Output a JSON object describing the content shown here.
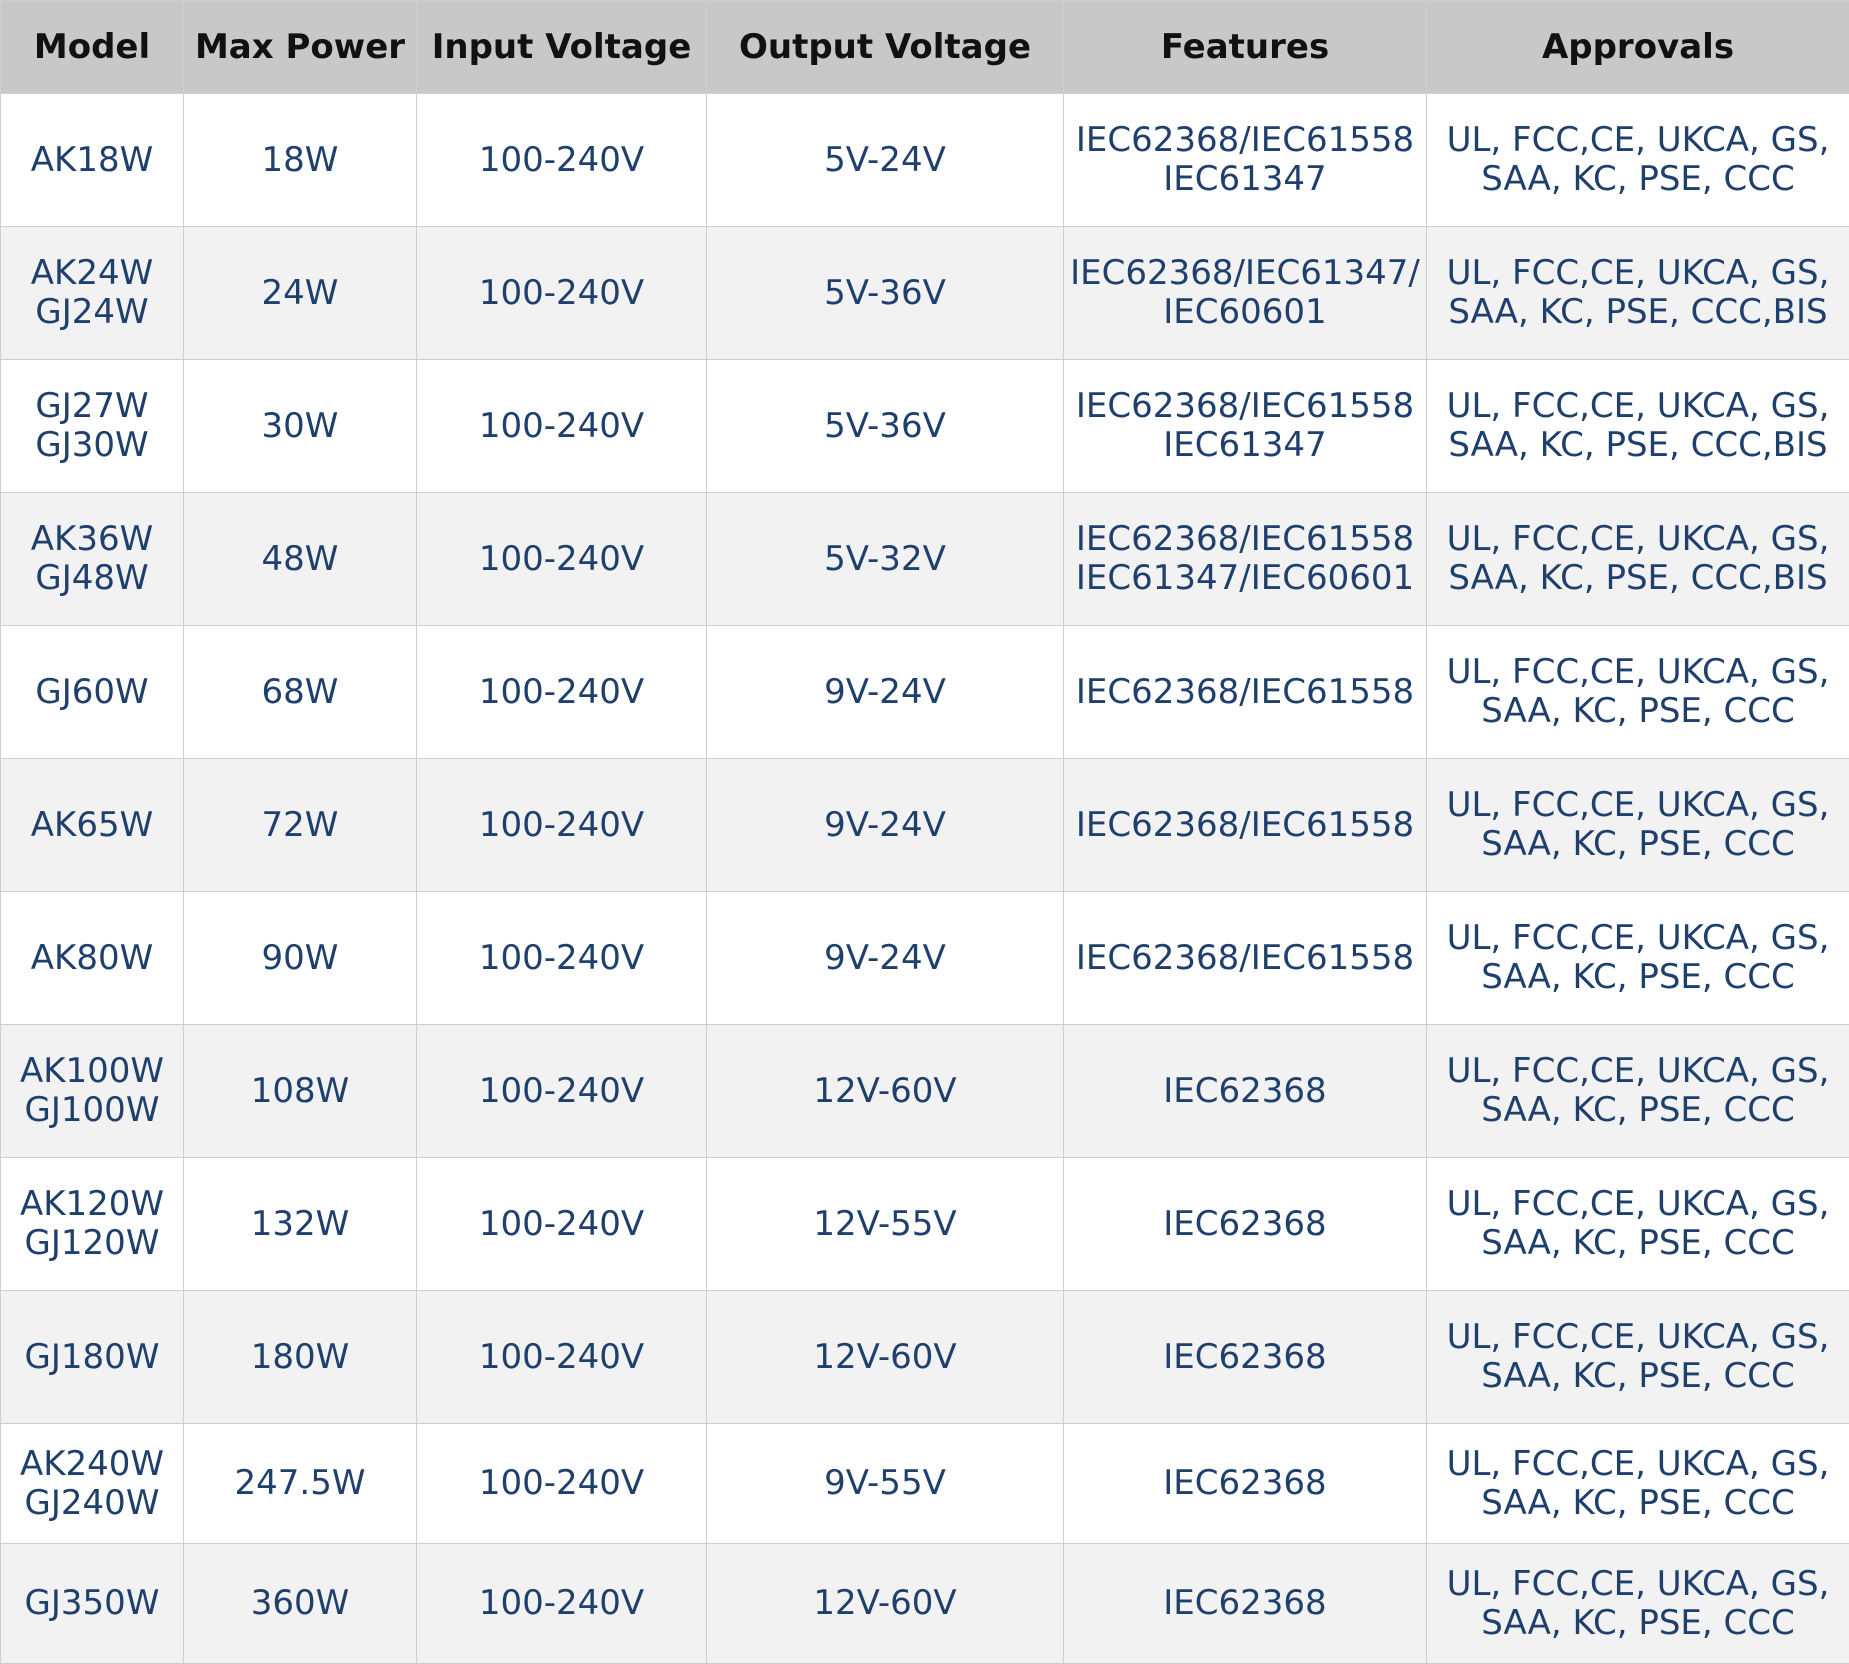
{
  "columns": [
    "Model",
    "Max Power",
    "Input Voltage",
    "Output Voltage",
    "Features",
    "Approvals"
  ],
  "rows": [
    {
      "model": "AK18W",
      "max_power": "18W",
      "input_voltage": "100-240V",
      "output_voltage": "5V-24V",
      "features": "IEC62368/IEC61558\nIEC61347",
      "approvals": "UL, FCC,CE, UKCA, GS,\nSAA, KC, PSE, CCC"
    },
    {
      "model": "AK24W\nGJ24W",
      "max_power": "24W",
      "input_voltage": "100-240V",
      "output_voltage": "5V-36V",
      "features": "IEC62368/IEC61347/\nIEC60601",
      "approvals": "UL, FCC,CE, UKCA, GS,\nSAA, KC, PSE, CCC,BIS"
    },
    {
      "model": "GJ27W\nGJ30W",
      "max_power": "30W",
      "input_voltage": "100-240V",
      "output_voltage": "5V-36V",
      "features": "IEC62368/IEC61558\nIEC61347",
      "approvals": "UL, FCC,CE, UKCA, GS,\nSAA, KC, PSE, CCC,BIS"
    },
    {
      "model": "AK36W\nGJ48W",
      "max_power": "48W",
      "input_voltage": "100-240V",
      "output_voltage": "5V-32V",
      "features": "IEC62368/IEC61558\nIEC61347/IEC60601",
      "approvals": "UL, FCC,CE, UKCA, GS,\nSAA, KC, PSE, CCC,BIS"
    },
    {
      "model": "GJ60W",
      "max_power": "68W",
      "input_voltage": "100-240V",
      "output_voltage": "9V-24V",
      "features": "IEC62368/IEC61558",
      "approvals": "UL, FCC,CE, UKCA, GS,\nSAA, KC, PSE, CCC"
    },
    {
      "model": "AK65W",
      "max_power": "72W",
      "input_voltage": "100-240V",
      "output_voltage": "9V-24V",
      "features": "IEC62368/IEC61558",
      "approvals": "UL, FCC,CE, UKCA, GS,\nSAA, KC, PSE, CCC"
    },
    {
      "model": "AK80W",
      "max_power": "90W",
      "input_voltage": "100-240V",
      "output_voltage": "9V-24V",
      "features": "IEC62368/IEC61558",
      "approvals": "UL, FCC,CE, UKCA, GS,\nSAA, KC, PSE, CCC"
    },
    {
      "model": "AK100W\nGJ100W",
      "max_power": "108W",
      "input_voltage": "100-240V",
      "output_voltage": "12V-60V",
      "features": "IEC62368",
      "approvals": "UL, FCC,CE, UKCA, GS,\nSAA, KC, PSE, CCC"
    },
    {
      "model": "AK120W\nGJ120W",
      "max_power": "132W",
      "input_voltage": "100-240V",
      "output_voltage": "12V-55V",
      "features": "IEC62368",
      "approvals": "UL, FCC,CE, UKCA, GS,\nSAA, KC, PSE, CCC"
    },
    {
      "model": "GJ180W",
      "max_power": "180W",
      "input_voltage": "100-240V",
      "output_voltage": "12V-60V",
      "features": "IEC62368",
      "approvals": "UL, FCC,CE, UKCA, GS,\nSAA, KC, PSE, CCC"
    },
    {
      "model": "AK240W\nGJ240W",
      "max_power": "247.5W",
      "input_voltage": "100-240V",
      "output_voltage": "9V-55V",
      "features": "IEC62368",
      "approvals": "UL, FCC,CE, UKCA, GS,\nSAA, KC, PSE, CCC"
    },
    {
      "model": "GJ350W",
      "max_power": "360W",
      "input_voltage": "100-240V",
      "output_voltage": "12V-60V",
      "features": "IEC62368",
      "approvals": "UL, FCC,CE, UKCA, GS,\nSAA, KC, PSE, CCC"
    }
  ]
}
